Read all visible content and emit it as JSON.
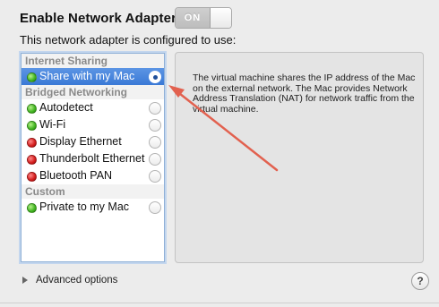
{
  "header": {
    "title": "Enable Network Adapter",
    "toggle_label": "ON"
  },
  "subtitle": "This network adapter is configured to use:",
  "list": {
    "sections": [
      {
        "header": "Internet Sharing",
        "items": [
          {
            "label": "Share with my Mac",
            "status": "green",
            "selected": true
          }
        ]
      },
      {
        "header": "Bridged Networking",
        "items": [
          {
            "label": "Autodetect",
            "status": "green",
            "selected": false
          },
          {
            "label": "Wi-Fi",
            "status": "green",
            "selected": false
          },
          {
            "label": "Display Ethernet",
            "status": "red",
            "selected": false
          },
          {
            "label": "Thunderbolt Ethernet",
            "status": "red",
            "selected": false
          },
          {
            "label": "Bluetooth PAN",
            "status": "red",
            "selected": false
          }
        ]
      },
      {
        "header": "Custom",
        "items": [
          {
            "label": "Private to my Mac",
            "status": "green",
            "selected": false
          }
        ]
      }
    ]
  },
  "description": "The virtual machine shares the IP address of the Mac on the external network. The Mac provides Network Address Translation (NAT) for network traffic from the virtual machine.",
  "footer": {
    "advanced_label": "Advanced options",
    "help_label": "?"
  },
  "colors": {
    "selection": "#3a79d6",
    "annotation_arrow": "#e2614f",
    "status_green": "#3fb31f",
    "status_red": "#d21b1b"
  }
}
